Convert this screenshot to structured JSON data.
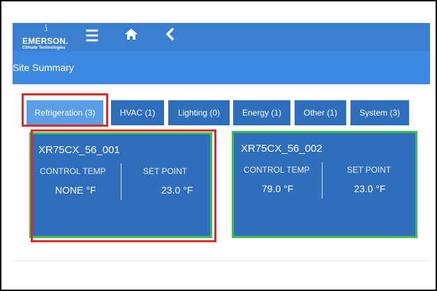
{
  "header": {
    "logo": {
      "brand": "EMERSON.",
      "sub": "Climate Technologies"
    },
    "icons": [
      "menu-icon",
      "home-icon",
      "back-icon"
    ]
  },
  "page": {
    "title": "Site Summary"
  },
  "tabs": [
    {
      "label": "Refrigeration (3)",
      "active": true
    },
    {
      "label": "HVAC (1)"
    },
    {
      "label": "Lighting (0)"
    },
    {
      "label": "Energy (1)"
    },
    {
      "label": "Other (1)"
    },
    {
      "label": "System (3)"
    }
  ],
  "cards": [
    {
      "name": "XR75CX_56_001",
      "left_label": "CONTROL TEMP",
      "right_label": "SET POINT",
      "control_temp": "NONE °F",
      "set_point": "23.0 °F"
    },
    {
      "name": "XR75CX_56_002",
      "left_label": "CONTROL TEMP",
      "right_label": "SET POINT",
      "control_temp": "79.0 °F",
      "set_point": "23.0 °F"
    }
  ],
  "colors": {
    "header": "#3b7fd1",
    "title_bar": "#3d88e0",
    "tab": "#2f6ebd",
    "tab_active": "#5b9ee8",
    "card": "#2f6ebd",
    "highlight_red": "#e02a2a",
    "highlight_green": "#3fbf4d"
  }
}
